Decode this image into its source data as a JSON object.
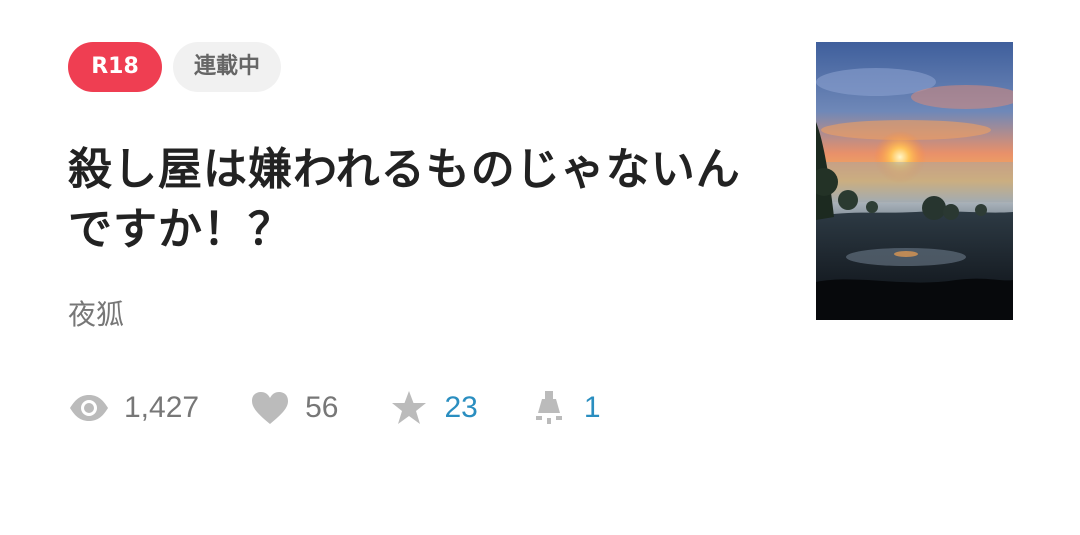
{
  "badges": {
    "rating": "R18",
    "status": "連載中"
  },
  "work": {
    "title": "殺し屋は嫌われるものじゃないんですか！？",
    "author": "夜狐"
  },
  "stats": {
    "views": {
      "icon": "eye-icon",
      "value": "1,427"
    },
    "likes": {
      "icon": "heart-icon",
      "value": "56"
    },
    "bookmarks": {
      "icon": "star-icon",
      "value": "23"
    },
    "comments": {
      "icon": "spotlight-icon",
      "value": "1"
    }
  },
  "colors": {
    "rating_badge_bg": "#ef3e52",
    "status_badge_bg": "#f1f1f1",
    "accent_value": "#2a8ec0",
    "muted_text": "#777777",
    "icon_gray": "#bbbbbb"
  },
  "cover": {
    "icon": "cover-image-sunset-landscape"
  }
}
